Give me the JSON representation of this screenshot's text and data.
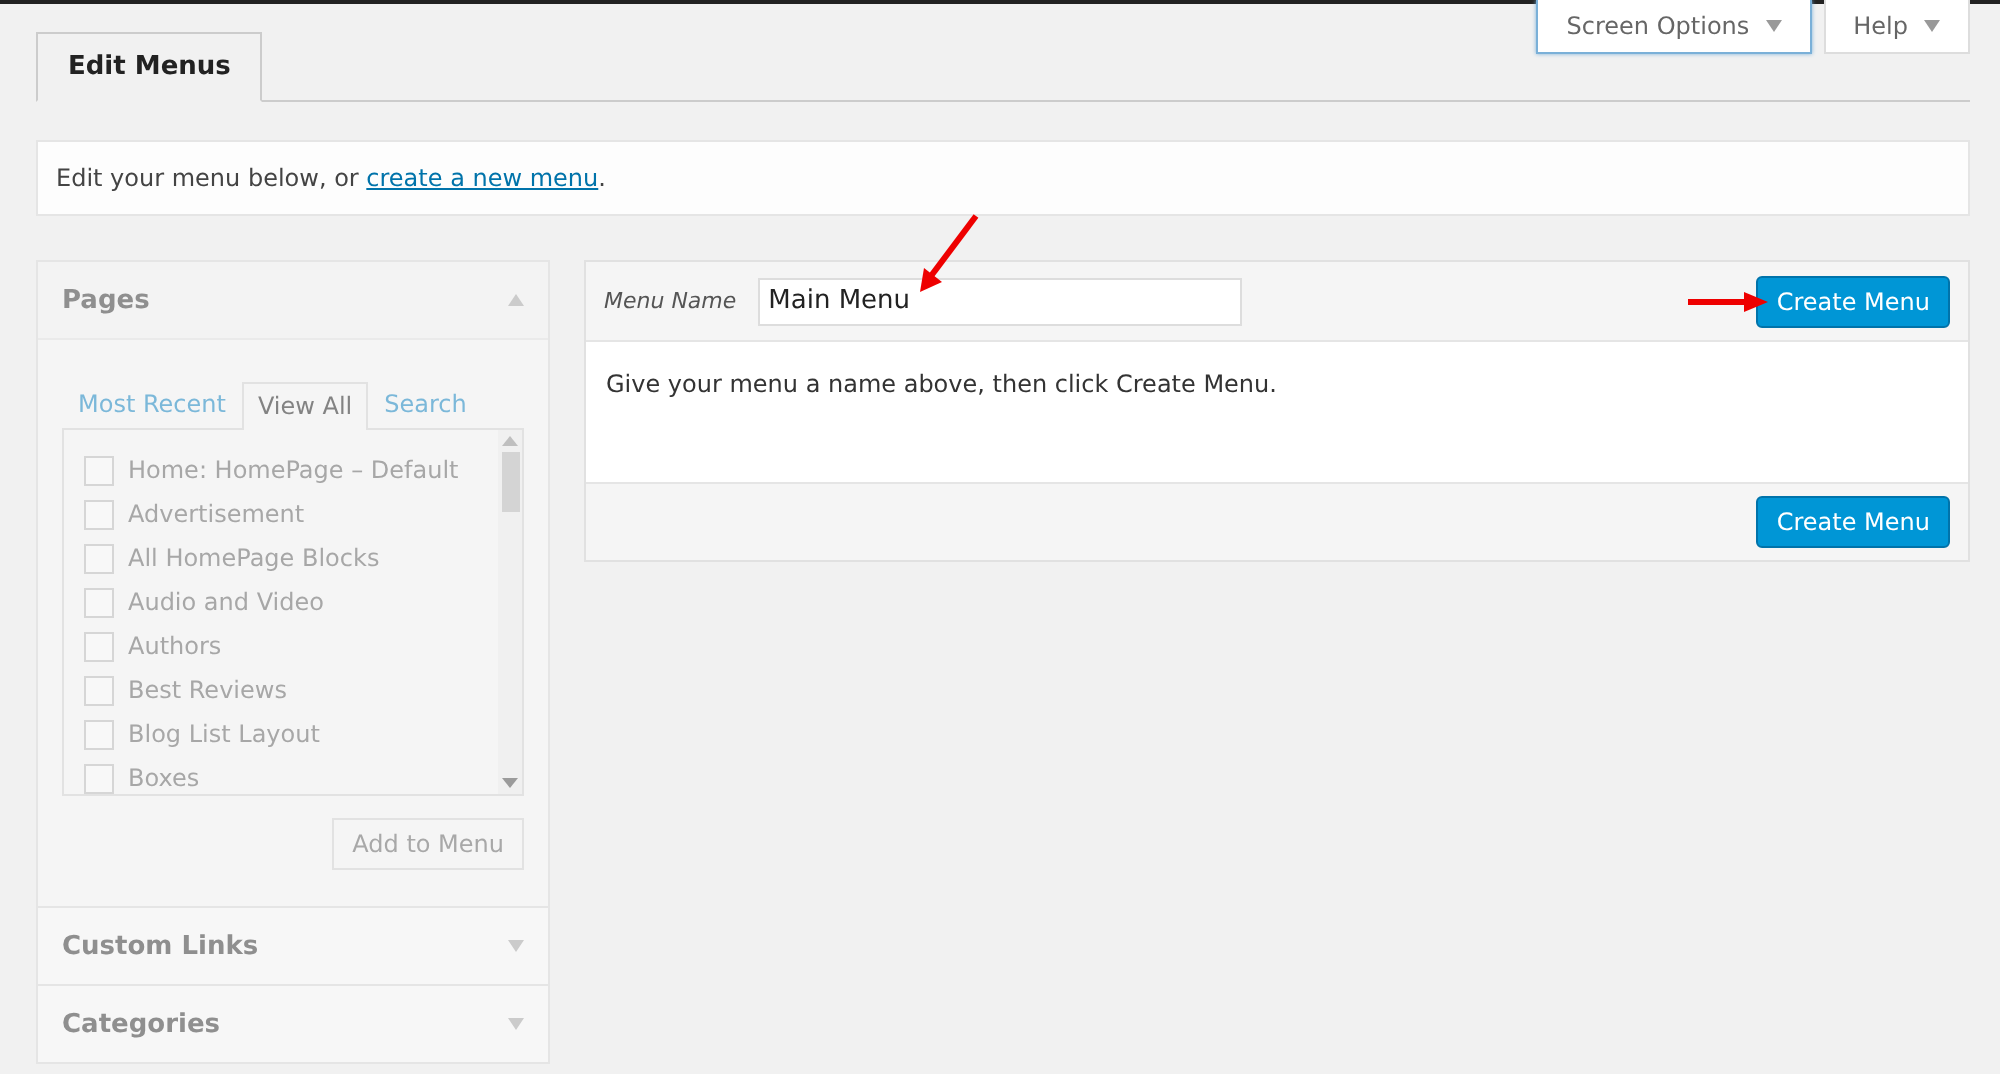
{
  "screen_meta": {
    "buttons": [
      {
        "label": "Screen Options",
        "selected": true
      },
      {
        "label": "Help",
        "selected": false
      }
    ]
  },
  "tabs": [
    {
      "label": "Edit Menus",
      "selected": true
    }
  ],
  "notice": {
    "text": "Edit your menu below, or ",
    "link": "create a new menu",
    "end": "."
  },
  "sidebar": {
    "disabled": true,
    "sections": [
      {
        "title": "Pages",
        "expanded": true,
        "tabs": [
          {
            "label": "Most Recent",
            "selected": false
          },
          {
            "label": "View All",
            "selected": true
          },
          {
            "label": "Search",
            "selected": false
          }
        ],
        "items": [
          {
            "label": "Home: HomePage – Default",
            "checked": false
          },
          {
            "label": "Advertisement",
            "checked": false
          },
          {
            "label": "All HomePage Blocks",
            "checked": false
          },
          {
            "label": "Audio and Video",
            "checked": false
          },
          {
            "label": "Authors",
            "checked": false
          },
          {
            "label": "Best Reviews",
            "checked": false
          },
          {
            "label": "Blog List Layout",
            "checked": false
          },
          {
            "label": "Boxes",
            "checked": false
          }
        ],
        "button": "Add to Menu"
      },
      {
        "title": "Custom Links",
        "expanded": false
      },
      {
        "title": "Categories",
        "expanded": false
      }
    ]
  },
  "menu_editor": {
    "name_label": "Menu Name",
    "name_value": "Main Menu",
    "create_button": "Create Menu",
    "instructions": "Give your menu a name above, then click Create Menu.",
    "footer_button": "Create Menu"
  }
}
